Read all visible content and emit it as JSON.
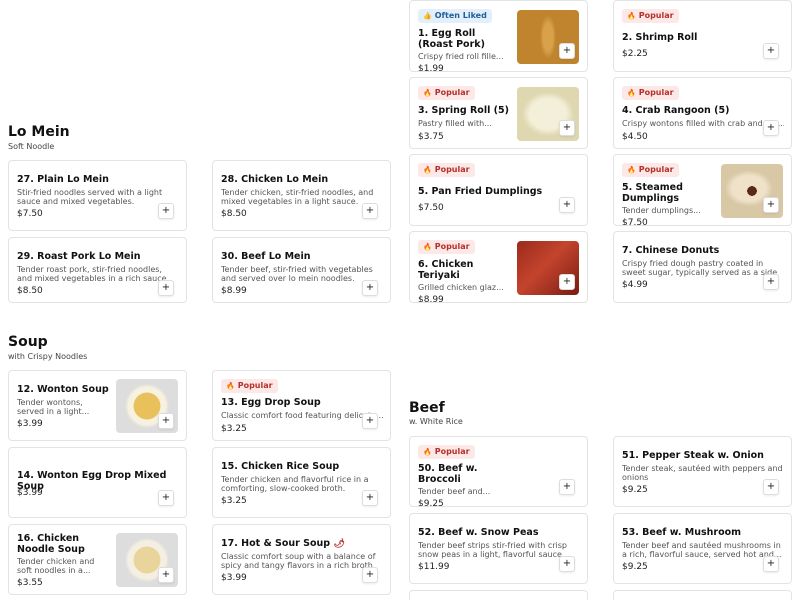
{
  "sections": {
    "lo_mein": {
      "title": "Lo Mein",
      "subtitle": "Soft Noodle"
    },
    "soup": {
      "title": "Soup",
      "subtitle": "with Crispy Noodles"
    },
    "beef": {
      "title": "Beef",
      "subtitle": "w. White Rice"
    }
  },
  "badges": {
    "popular": "Popular",
    "often_liked": "Often Liked"
  },
  "icons": {
    "add": "plus-icon",
    "popular": "fire-icon",
    "often_liked": "thumbs-up-icon",
    "spicy": "pepper-icon"
  },
  "add_glyph": "+",
  "appetizers": [
    {
      "name": "1. Egg Roll (Roast Pork)",
      "desc": "Crispy fried roll fille...",
      "price": "$1.99",
      "badge": "often_liked",
      "image": "egg-roll"
    },
    {
      "name": "2. Shrimp Roll",
      "desc": "",
      "price": "$2.25",
      "badge": "popular"
    },
    {
      "name": "3. Spring Roll (5)",
      "desc": "Pastry filled with...",
      "price": "$3.75",
      "badge": "popular",
      "image": "spring-roll"
    },
    {
      "name": "4. Crab Rangoon (5)",
      "desc": "Crispy wontons filled with crab and cre...",
      "price": "$4.50",
      "badge": "popular"
    },
    {
      "name": "5. Pan Fried Dumplings",
      "desc": "",
      "price": "$7.50",
      "badge": "popular"
    },
    {
      "name": "5. Steamed Dumplings",
      "desc": "Tender dumplings...",
      "price": "$7.50",
      "badge": "popular",
      "image": "steamed-dumplings"
    },
    {
      "name": "6. Chicken Teriyaki",
      "desc": "Grilled chicken glaz...",
      "price": "$8.99",
      "badge": "popular",
      "image": "chicken-teriyaki"
    },
    {
      "name": "7. Chinese Donuts",
      "desc": "Crispy fried dough pastry coated in sweet sugar, typically served as a side or dessert.",
      "price": "$4.99"
    }
  ],
  "lo_mein_items": [
    {
      "name": "27. Plain Lo Mein",
      "desc": "Stir-fried noodles served with a light sauce and mixed vegetables.",
      "price": "$7.50"
    },
    {
      "name": "28. Chicken Lo Mein",
      "desc": "Tender chicken, stir-fried noodles, and mixed vegetables in a light sauce.",
      "price": "$8.50"
    },
    {
      "name": "29. Roast Pork Lo Mein",
      "desc": "Tender roast pork, stir-fried noodles, and mixed vegetables in a rich sauce.",
      "price": "$8.50"
    },
    {
      "name": "30. Beef Lo Mein",
      "desc": "Tender beef, stir-fried with vegetables and served over lo mein noodles.",
      "price": "$8.99"
    }
  ],
  "soup_items": [
    {
      "name": "12. Wonton Soup",
      "desc": "Tender wontons, served in a light...",
      "price": "$3.99",
      "image": "wonton-soup"
    },
    {
      "name": "13. Egg Drop Soup",
      "desc": "Classic comfort food featuring delicate...",
      "price": "$3.25",
      "badge": "popular"
    },
    {
      "name": "14. Wonton Egg Drop Mixed Soup",
      "desc": "",
      "price": "$3.99"
    },
    {
      "name": "15. Chicken Rice Soup",
      "desc": "Tender chicken and flavorful rice in a comforting, slow-cooked broth.",
      "price": "$3.25"
    },
    {
      "name": "16. Chicken Noodle Soup",
      "desc": "Tender chicken and soft noodles in a...",
      "price": "$3.55",
      "image": "chicken-noodle-soup"
    },
    {
      "name": "17. Hot & Sour Soup",
      "desc": "Classic comfort soup with a balance of spicy and tangy flavors in a rich broth.",
      "price": "$3.99",
      "spicy": "🌶"
    }
  ],
  "beef_items": [
    {
      "name": "50. Beef w. Broccoli",
      "desc": "Tender beef and...",
      "price": "$9.25",
      "badge": "popular"
    },
    {
      "name": "51. Pepper Steak w. Onion",
      "desc": "Tender steak, sautéed with peppers and onions",
      "price": "$9.25"
    },
    {
      "name": "52. Beef w. Snow Peas",
      "desc": "Tender beef strips stir-fried with crisp snow peas in a light, flavorful sauce.",
      "price": "$11.99"
    },
    {
      "name": "53. Beef w. Mushroom",
      "desc": "Tender beef and sautéed mushrooms in a rich, flavorful sauce, served hot and...",
      "price": "$9.25"
    }
  ]
}
